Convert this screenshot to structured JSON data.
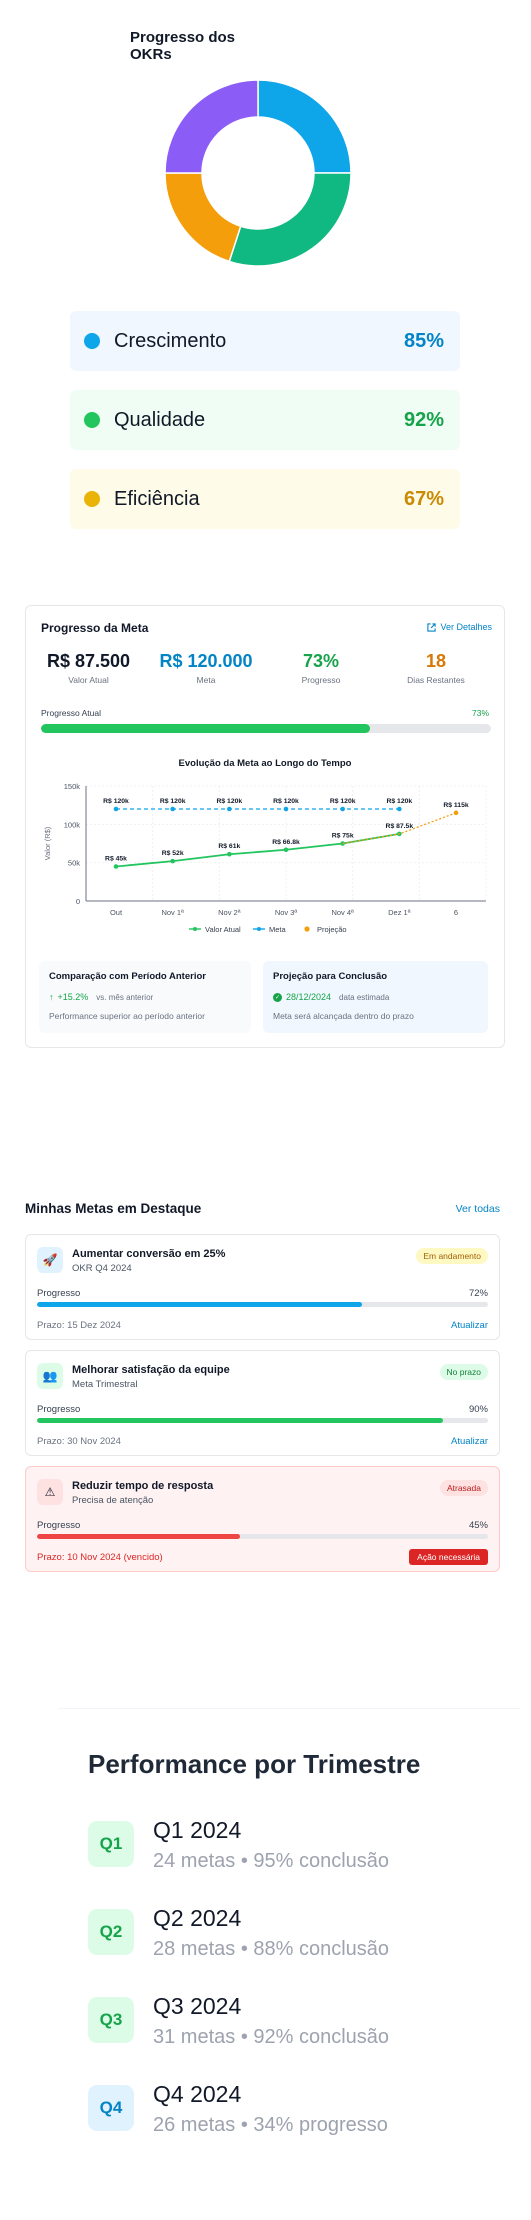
{
  "okr": {
    "title": "Progresso dos OKRs",
    "chart_data": {
      "type": "pie",
      "title": "Progresso dos OKRs",
      "slices": [
        {
          "value": 25,
          "color": "#0ea5e9"
        },
        {
          "value": 30,
          "color": "#10b981"
        },
        {
          "value": 20,
          "color": "#f59e0b"
        },
        {
          "value": 25,
          "color": "#8b5cf6"
        }
      ]
    },
    "items": [
      {
        "label": "Crescimento",
        "value": "85%",
        "dot": "#0ea5e9",
        "bg": "#f0f7fe",
        "color": "#0284c7"
      },
      {
        "label": "Qualidade",
        "value": "92%",
        "dot": "#22c55e",
        "bg": "#f0fdf4",
        "color": "#16a34a"
      },
      {
        "label": "Eficiência",
        "value": "67%",
        "dot": "#eab308",
        "bg": "#fefce8",
        "color": "#ca8a04"
      }
    ]
  },
  "goal": {
    "title": "Progresso da Meta",
    "details_link": "Ver Detalhes",
    "stats": [
      {
        "value": "R$ 87.500",
        "label": "Valor Atual",
        "color": "#111827"
      },
      {
        "value": "R$ 120.000",
        "label": "Meta",
        "color": "#0284c7"
      },
      {
        "value": "73%",
        "label": "Progresso",
        "color": "#16a34a"
      },
      {
        "value": "18",
        "label": "Dias Restantes",
        "color": "#d97706"
      }
    ],
    "progress_label": "Progresso Atual",
    "progress_value": "73%",
    "progress_fraction": 0.73,
    "comparison": {
      "title": "Comparação com Período Anterior",
      "value": "+15.2%",
      "value_note": "vs. mês anterior",
      "note": "Performance superior ao período anterior"
    },
    "projection": {
      "title": "Projeção para Conclusão",
      "value": "28/12/2024",
      "value_note": "data estimada",
      "note": "Meta será alcançada dentro do prazo"
    }
  },
  "chart_data": {
    "type": "line",
    "title": "Evolução da Meta ao Longo do Tempo",
    "ylabel": "Valor (R$)",
    "xlabel": "",
    "categories": [
      "Out",
      "Nov 1ª",
      "Nov 2ª",
      "Nov 3ª",
      "Nov 4ª",
      "Dez 1ª",
      "6"
    ],
    "ylim": [
      0,
      150000
    ],
    "yticks": [
      "0",
      "50k",
      "100k",
      "150k"
    ],
    "grid": true,
    "legend": "bottom",
    "series": [
      {
        "name": "Valor Atual",
        "color": "#22c55e",
        "values": [
          45000,
          52000,
          61000,
          66800,
          75000,
          87500,
          null
        ],
        "labels": [
          "R$ 45k",
          "R$ 52k",
          "R$ 61k",
          "R$ 66.8k",
          "R$ 75k",
          "R$ 87.5k",
          ""
        ]
      },
      {
        "name": "Meta",
        "color": "#0ea5e9",
        "values": [
          120000,
          120000,
          120000,
          120000,
          120000,
          120000,
          null
        ],
        "labels": [
          "R$ 120k",
          "R$ 120k",
          "R$ 120k",
          "R$ 120k",
          "R$ 120k",
          "R$ 120k",
          ""
        ]
      },
      {
        "name": "Projeção",
        "color": "#f59e0b",
        "values": [
          null,
          null,
          null,
          null,
          75000,
          87500,
          115000
        ],
        "labels": [
          "",
          "",
          "",
          "",
          "",
          "",
          "R$ 115k"
        ]
      }
    ]
  },
  "metas": {
    "title": "Minhas Metas em Destaque",
    "view_all": "Ver todas",
    "items": [
      {
        "name": "Aumentar conversão em 25%",
        "sub": "OKR Q4 2024",
        "badge": "Em andamento",
        "badge_bg": "#fef9c3",
        "badge_color": "#a16207",
        "progress_label": "Progresso",
        "progress": "72%",
        "fraction": 0.72,
        "bar": "#0ea5e9",
        "deadline": "Prazo: 15 Dez 2024",
        "action": "Atualizar",
        "icon": "rocket-icon",
        "icon_glyph": "🚀",
        "icon_bg": "#e0f2fe"
      },
      {
        "name": "Melhorar satisfação da equipe",
        "sub": "Meta Trimestral",
        "badge": "No prazo",
        "badge_bg": "#dcfce7",
        "badge_color": "#15803d",
        "progress_label": "Progresso",
        "progress": "90%",
        "fraction": 0.9,
        "bar": "#22c55e",
        "deadline": "Prazo: 30 Nov 2024",
        "action": "Atualizar",
        "icon": "team-icon",
        "icon_glyph": "👥",
        "icon_bg": "#dcfce7"
      },
      {
        "name": "Reduzir tempo de resposta",
        "sub": "Precisa de atenção",
        "badge": "Atrasada",
        "badge_bg": "#fee2e2",
        "badge_color": "#b91c1c",
        "progress_label": "Progresso",
        "progress": "45%",
        "fraction": 0.45,
        "bar": "#ef4444",
        "deadline": "Prazo: 10 Nov 2024 (vencido)",
        "action": "Ação necessária",
        "icon": "warning-icon",
        "icon_glyph": "⚠",
        "icon_bg": "#fee2e2"
      }
    ]
  },
  "performance": {
    "title": "Performance por Trimestre",
    "quarters": [
      {
        "badge": "Q1",
        "name": "Q1 2024",
        "sub": "24 metas • 95% conclusão",
        "bg": "#dcfce7",
        "color": "#16a34a"
      },
      {
        "badge": "Q2",
        "name": "Q2 2024",
        "sub": "28 metas • 88% conclusão",
        "bg": "#dcfce7",
        "color": "#16a34a"
      },
      {
        "badge": "Q3",
        "name": "Q3 2024",
        "sub": "31 metas • 92% conclusão",
        "bg": "#dcfce7",
        "color": "#16a34a"
      },
      {
        "badge": "Q4",
        "name": "Q4 2024",
        "sub": "26 metas • 34% progresso",
        "bg": "#e0f2fe",
        "color": "#0284c7"
      }
    ]
  }
}
